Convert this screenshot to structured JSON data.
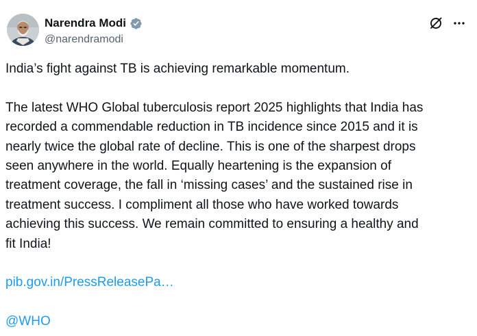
{
  "author": {
    "display_name": "Narendra Modi",
    "handle": "@narendramodi",
    "verified_icon": "verified-badge-icon",
    "avatar_icon": "profile-avatar"
  },
  "actions": {
    "grok_icon": "grok-icon",
    "more_icon": "more-icon"
  },
  "tweet": {
    "line1": "India’s fight against TB is achieving remarkable momentum.",
    "paragraph2": "The latest WHO Global tuberculosis report 2025 highlights that India has\nrecorded a commendable reduction in TB incidence since 2015 and it is\nnearly twice the global rate of decline. This is one of the sharpest drops\nseen anywhere in the world. Equally heartening is the expansion of\ntreatment coverage, the fall in ‘missing cases’ and the sustained rise in\ntreatment success. I compliment all those who have worked towards\nachieving this success. We remain committed to ensuring a healthy and\nfit India!",
    "link": "pib.gov.in/PressReleasePa…",
    "mention": "@WHO"
  },
  "colors": {
    "link": "#1d9bf0",
    "text": "#0f1419",
    "secondary": "#536471",
    "verified": "#829aab"
  }
}
